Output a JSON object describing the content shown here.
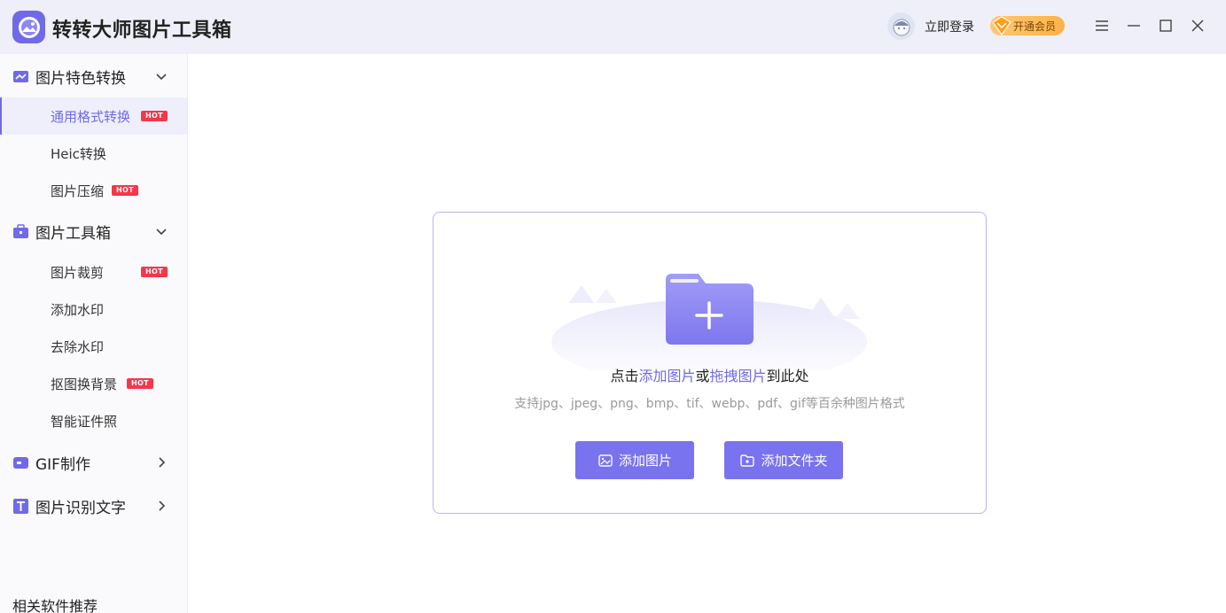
{
  "app": {
    "title": "转转大师图片工具箱",
    "accent_color": "#6f6ae8",
    "logo_icon": "photo-app-icon"
  },
  "header": {
    "login_label": "立即登录",
    "vip_label": "开通会员",
    "avatar_icon": "user-avatar-icon",
    "window_controls": [
      "menu-icon",
      "minimize-icon",
      "maximize-icon",
      "close-icon"
    ]
  },
  "sidebar": {
    "groups": [
      {
        "label": "图片特色转换",
        "icon": "image-convert-icon",
        "expanded": true,
        "items": [
          {
            "label": "通用格式转换",
            "hot": "HOT",
            "active": true
          },
          {
            "label": "Heic转换"
          },
          {
            "label": "图片压缩",
            "hot": "HOT"
          }
        ]
      },
      {
        "label": "图片工具箱",
        "icon": "toolbox-icon",
        "expanded": true,
        "items": [
          {
            "label": "图片裁剪",
            "hot": "HOT"
          },
          {
            "label": "添加水印"
          },
          {
            "label": "去除水印"
          },
          {
            "label": "抠图换背景",
            "hot": "HOT"
          },
          {
            "label": "智能证件照"
          }
        ]
      },
      {
        "label": "GIF制作",
        "icon": "gif-icon",
        "expanded": false
      },
      {
        "label": "图片识别文字",
        "icon": "text-recognition-icon",
        "expanded": false
      }
    ],
    "recommend_label": "相关软件推荐"
  },
  "dropzone": {
    "hint_prefix": "点击",
    "hint_link1": "添加图片",
    "hint_mid": "或",
    "hint_link2": "拖拽图片",
    "hint_suffix": "到此处",
    "formats": "支持jpg、jpeg、png、bmp、tif、webp、pdf、gif等百余种图片格式",
    "add_image_label": "添加图片",
    "add_folder_label": "添加文件夹",
    "folder_icon": "folder-plus-icon"
  }
}
